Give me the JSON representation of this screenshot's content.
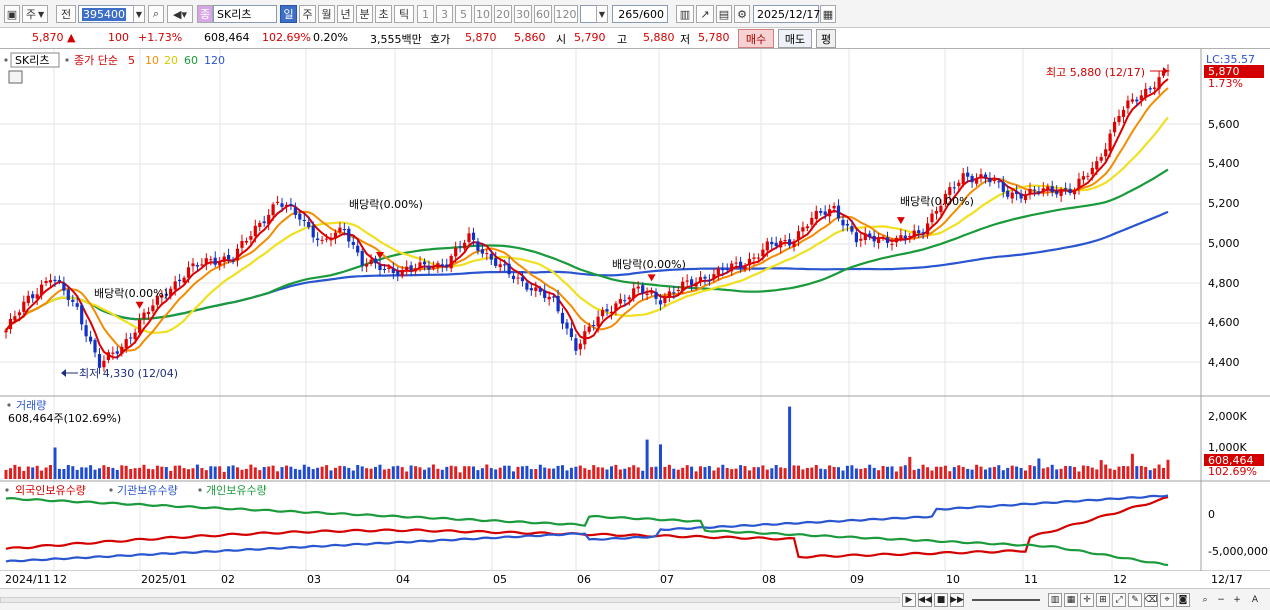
{
  "toolbar": {
    "period_unit": "주",
    "prev_label": "전",
    "stock_code": "395400",
    "stock_badge": "종",
    "stock_name": "SK리츠",
    "periods": [
      "일",
      "주",
      "월",
      "년",
      "분",
      "초",
      "틱"
    ],
    "selected_period": "일",
    "intervals": [
      "1",
      "3",
      "5",
      "10",
      "20",
      "30",
      "60",
      "120"
    ],
    "count_value": "265",
    "count_total": "/600",
    "date_value": "2025/12/17"
  },
  "quote": {
    "price": "5,870",
    "change_arrow": "▲",
    "change": "100",
    "change_pct": "+1.73%",
    "volume": "608,464",
    "volume_ratio": "102.69%",
    "turnover": "0.20%",
    "amount": "3,555백만",
    "bid_label": "호가",
    "bid": "5,870",
    "ask": "5,860",
    "open_label": "시",
    "open": "5,790",
    "high_label": "고",
    "high": "5,880",
    "low_label": "저",
    "low": "5,780",
    "buy_button": "매수",
    "sell_button": "매도",
    "eval_button": "평"
  },
  "price_panel": {
    "stock_tag": "SK리츠",
    "legend_title": "종가 단순",
    "ma_legend": [
      {
        "label": "5",
        "color": "#dd0000"
      },
      {
        "label": "10",
        "color": "#f28c00"
      },
      {
        "label": "20",
        "color": "#f0e020"
      },
      {
        "label": "60",
        "color": "#1a9a3a"
      },
      {
        "label": "120",
        "color": "#2a55d0"
      }
    ],
    "lc_label": "LC:35.57",
    "last_price_tag": "5,870",
    "last_pct_tag": "1.73%",
    "high_annotation": "최고 5,880 (12/17)",
    "low_annotation": "최저 4,330 (12/04)",
    "dividend_label": "배당락(0.00%)",
    "y_ticks": [
      "5,600",
      "5,400",
      "5,200",
      "5,000",
      "4,800",
      "4,600",
      "4,400"
    ]
  },
  "volume_panel": {
    "title": "거래량",
    "subtitle": "608,464주(102.69%)",
    "y_ticks": [
      "2,000K",
      "1,000K"
    ],
    "last_tag": "608,464",
    "last_pct_tag": "102.69%"
  },
  "holdings_panel": {
    "legends": [
      {
        "label": "외국인보유수량",
        "color": "#d40000"
      },
      {
        "label": "기관보유수량",
        "color": "#2a55d0"
      },
      {
        "label": "개인보유수량",
        "color": "#1a9a3a"
      }
    ],
    "y_ticks": [
      "0",
      "-5,000,000"
    ]
  },
  "x_axis": {
    "labels": [
      "2024/11",
      "12",
      "2025/01",
      "02",
      "03",
      "04",
      "05",
      "06",
      "07",
      "08",
      "09",
      "10",
      "11",
      "12"
    ],
    "last_date": "12/17"
  },
  "chart_data": {
    "type": "candlestick",
    "title": "SK리츠",
    "ylim": [
      4300,
      5900
    ],
    "price_path": [
      [
        0,
        4560
      ],
      [
        5,
        4720
      ],
      [
        10,
        4830
      ],
      [
        16,
        4670
      ],
      [
        21,
        4380
      ],
      [
        26,
        4480
      ],
      [
        31,
        4630
      ],
      [
        36,
        4760
      ],
      [
        41,
        4860
      ],
      [
        46,
        4920
      ],
      [
        51,
        4920
      ],
      [
        56,
        5080
      ],
      [
        61,
        5200
      ],
      [
        66,
        5140
      ],
      [
        71,
        4990
      ],
      [
        76,
        5080
      ],
      [
        80,
        4900
      ],
      [
        85,
        4870
      ],
      [
        89,
        4860
      ],
      [
        94,
        4880
      ],
      [
        99,
        4900
      ],
      [
        104,
        5030
      ],
      [
        109,
        4920
      ],
      [
        113,
        4840
      ],
      [
        118,
        4780
      ],
      [
        123,
        4700
      ],
      [
        128,
        4480
      ],
      [
        133,
        4620
      ],
      [
        137,
        4700
      ],
      [
        142,
        4760
      ],
      [
        147,
        4720
      ],
      [
        152,
        4780
      ],
      [
        157,
        4830
      ],
      [
        161,
        4860
      ],
      [
        166,
        4900
      ],
      [
        171,
        4980
      ],
      [
        176,
        5010
      ],
      [
        181,
        5120
      ],
      [
        186,
        5180
      ],
      [
        191,
        5010
      ],
      [
        195,
        5030
      ],
      [
        200,
        5010
      ],
      [
        205,
        5050
      ],
      [
        210,
        5200
      ],
      [
        215,
        5340
      ],
      [
        220,
        5330
      ],
      [
        225,
        5250
      ],
      [
        230,
        5250
      ],
      [
        235,
        5270
      ],
      [
        240,
        5270
      ],
      [
        245,
        5400
      ],
      [
        250,
        5650
      ],
      [
        255,
        5750
      ],
      [
        261,
        5870
      ]
    ],
    "volume_bars": [
      {
        "day": 11,
        "value": 1000
      },
      {
        "day": 144,
        "value": 1250
      },
      {
        "day": 147,
        "value": 1100
      },
      {
        "day": 176,
        "value": 2300
      },
      {
        "day": 203,
        "value": 700
      },
      {
        "day": 232,
        "value": 650
      },
      {
        "day": 246,
        "value": 600
      },
      {
        "day": 253,
        "value": 800
      },
      {
        "day": 261,
        "value": 608.464
      }
    ],
    "holdings_ylim": [
      -7000000,
      3000000
    ],
    "dividend_markers_day": [
      30,
      84,
      145,
      201
    ]
  }
}
